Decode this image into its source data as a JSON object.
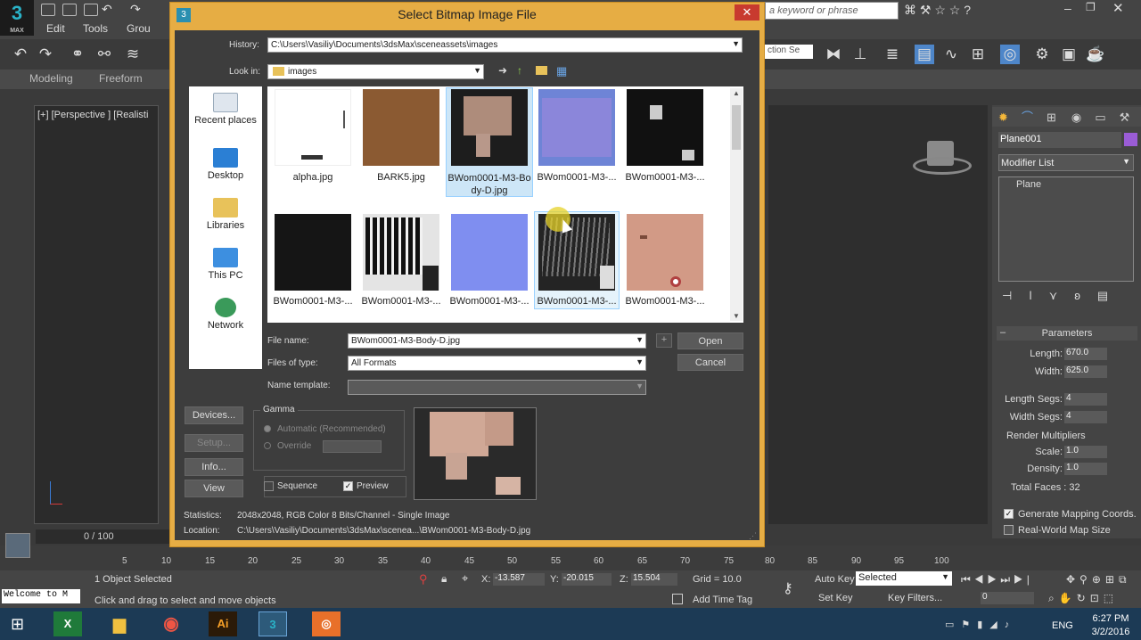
{
  "app": {
    "logo": "3",
    "logo_sub": "MAX",
    "menus": [
      "Edit",
      "Tools",
      "Grou"
    ],
    "search_placeholder": "a keyword or phrase",
    "ribbon_tabs": [
      "Modeling",
      "Freeform"
    ],
    "viewport_label": "[+] [Perspective ] [Realisti",
    "named_sel": "ction Se"
  },
  "dialog": {
    "title": "Select Bitmap Image File",
    "history_label": "History:",
    "history_value": "C:\\Users\\Vasiliy\\Documents\\3dsMax\\sceneassets\\images",
    "lookin_label": "Look in:",
    "lookin_value": "images",
    "places": [
      "Recent places",
      "Desktop",
      "Libraries",
      "This PC",
      "Network"
    ],
    "files": [
      {
        "name": "alpha.jpg",
        "color": "#ffffff"
      },
      {
        "name": "BARK5.jpg",
        "color": "#8b5a32"
      },
      {
        "name": "BWom0001-M3-Bo dy-D.jpg",
        "color": "#1d1d1d"
      },
      {
        "name": "BWom0001-M3-...",
        "color": "#6e84d6"
      },
      {
        "name": "BWom0001-M3-...",
        "color": "#111111"
      },
      {
        "name": "BWom0001-M3-...",
        "color": "#151515"
      },
      {
        "name": "BWom0001-M3-...",
        "color": "#e4e4e4"
      },
      {
        "name": "BWom0001-M3-...",
        "color": "#7f8ef0"
      },
      {
        "name": "BWom0001-M3-...",
        "color": "#242424"
      },
      {
        "name": "BWom0001-M3-...",
        "color": "#d29a86"
      }
    ],
    "filename_label": "File name:",
    "filename_value": "BWom0001-M3-Body-D.jpg",
    "filetype_label": "Files of type:",
    "filetype_value": "All Formats",
    "nametemplate_label": "Name template:",
    "open_label": "Open",
    "cancel_label": "Cancel",
    "devices_label": "Devices...",
    "setup_label": "Setup...",
    "info_label": "Info...",
    "view_label": "View",
    "gamma_label": "Gamma",
    "gamma_auto": "Automatic (Recommended)",
    "gamma_override": "Override",
    "sequence_label": "Sequence",
    "preview_label": "Preview",
    "statistics_label": "Statistics:",
    "statistics_value": "2048x2048, RGB Color 8 Bits/Channel - Single Image",
    "location_label": "Location:",
    "location_value": "C:\\Users\\Vasiliy\\Documents\\3dsMax\\scenea...\\BWom0001-M3-Body-D.jpg"
  },
  "command_panel": {
    "object_name": "Plane001",
    "object_color": "#9a5cd6",
    "modifier_list": "Modifier List",
    "stack_item": "Plane",
    "parameters_title": "Parameters",
    "length_label": "Length:",
    "length_value": "670.0",
    "width_label": "Width:",
    "width_value": "625.0",
    "length_segs_label": "Length Segs:",
    "length_segs_value": "4",
    "width_segs_label": "Width Segs:",
    "width_segs_value": "4",
    "render_mult": "Render Multipliers",
    "scale_label": "Scale:",
    "scale_value": "1.0",
    "density_label": "Density:",
    "density_value": "1.0",
    "total_faces": "Total Faces : 32",
    "gen_mapping": "Generate Mapping Coords.",
    "realworld": "Real-World Map Size"
  },
  "timeline": {
    "frame": "0 / 100",
    "ticks": [
      "5",
      "10",
      "15",
      "20",
      "25",
      "30",
      "35",
      "40",
      "45",
      "50",
      "55",
      "60",
      "65",
      "70",
      "75",
      "80",
      "85",
      "90",
      "95",
      "100"
    ]
  },
  "status": {
    "selected": "1 Object Selected",
    "hint": "Click and drag to select and move objects",
    "welcome": "Welcome to M",
    "x_label": "X:",
    "x_value": "-13.587",
    "y_label": "Y:",
    "y_value": "-20.015",
    "z_label": "Z:",
    "z_value": "15.504",
    "grid": "Grid = 10.0",
    "add_time_tag": "Add Time Tag",
    "auto_key": "Auto Key",
    "set_key": "Set Key",
    "selected_dd": "Selected",
    "key_filters": "Key Filters...",
    "frame_field": "0"
  },
  "taskbar": {
    "lang": "ENG",
    "time": "6:27 PM",
    "date": "3/2/2016",
    "ai_label": "Ai"
  }
}
